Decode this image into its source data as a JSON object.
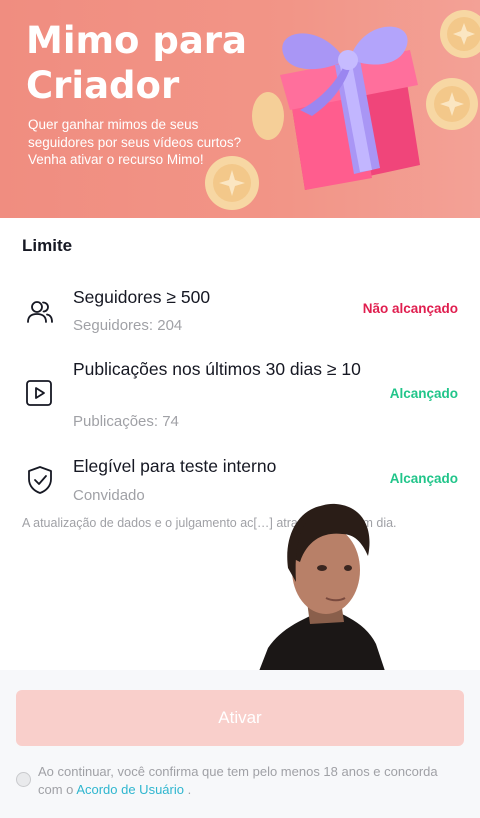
{
  "hero": {
    "title": "Mimo para Criador",
    "subtitle": "Quer ganhar mimos de seus seguidores por seus vídeos curtos? Venha ativar o recurso Mimo!"
  },
  "limits": {
    "title": "Limite",
    "items": [
      {
        "icon": "followers-icon",
        "name": "Seguidores ≥ 500",
        "detail": "Seguidores: 204",
        "status": "Não alcançado"
      },
      {
        "icon": "video-play-icon",
        "name": "Publicações nos últimos 30 dias ≥ 10",
        "detail": "Publicações: 74",
        "status": "Alcançado"
      },
      {
        "icon": "shield-check-icon",
        "name": "Elegível para teste interno",
        "detail": "Convidado",
        "status": "Alcançado"
      }
    ],
    "note": "A atualização de dados e o julgamento ac[…] atrasados em um dia."
  },
  "footer": {
    "activate_label": "Ativar",
    "consent_text": "Ao continuar, você confirma que tem pelo menos 18 anos e concorda com o",
    "consent_link": "Acordo de Usuário",
    "consent_end": "."
  },
  "colors": {
    "hero_bg": "#f08d80",
    "status_not_reached": "#e01e4f",
    "status_reached": "#21c58a",
    "button_disabled": "#f9cfcb",
    "link": "#2fb6cf"
  }
}
